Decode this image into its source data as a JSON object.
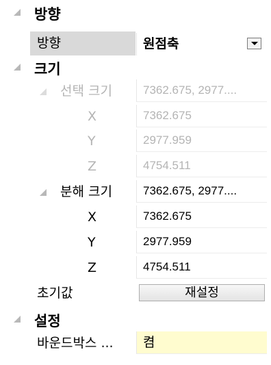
{
  "direction_section": {
    "title": "방향",
    "direction_label": "방향",
    "direction_value": "원점축"
  },
  "size_section": {
    "title": "크기",
    "selection_size": {
      "label": "선택 크기",
      "value": "7362.675, 2977....",
      "x_label": "X",
      "x_value": "7362.675",
      "y_label": "Y",
      "y_value": "2977.959",
      "z_label": "Z",
      "z_value": "4754.511"
    },
    "exploded_size": {
      "label": "분해 크기",
      "value": "7362.675, 2977....",
      "x_label": "X",
      "x_value": "7362.675",
      "y_label": "Y",
      "y_value": "2977.959",
      "z_label": "Z",
      "z_value": "4754.511"
    },
    "initial_label": "초기값",
    "reset_button": "재설정"
  },
  "settings_section": {
    "title": "설정",
    "bounding_box_label": "바운드박스 ...",
    "bounding_box_value": "켬"
  }
}
